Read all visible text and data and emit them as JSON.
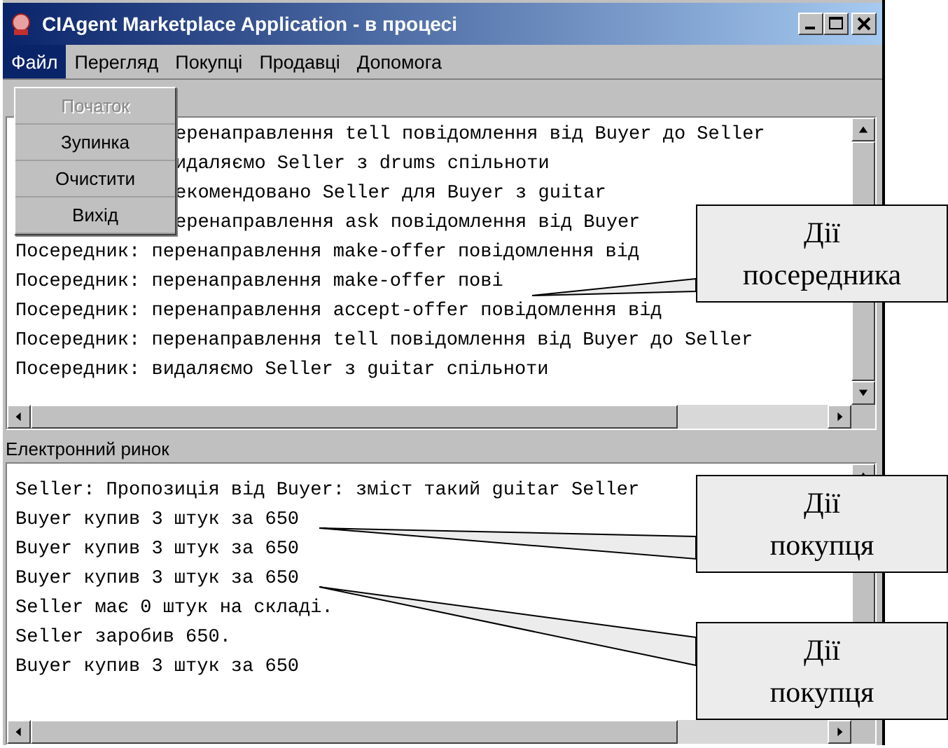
{
  "window": {
    "title": "CIAgent Marketplace Application - в процесі"
  },
  "menu_bar": [
    {
      "label": "Файл",
      "selected": true
    },
    {
      "label": "Перегляд",
      "selected": false
    },
    {
      "label": "Покупці",
      "selected": false
    },
    {
      "label": "Продавці",
      "selected": false
    },
    {
      "label": "Допомога",
      "selected": false
    }
  ],
  "file_menu": [
    {
      "label": "Початок",
      "disabled": true
    },
    {
      "label": "Зупинка",
      "disabled": false
    },
    {
      "label": "Очистити",
      "disabled": false
    },
    {
      "label": "Вихід",
      "disabled": false
    }
  ],
  "log_panel": {
    "lines": [
      {
        "text": "еренаправлення tell повідомлення від Buyer до Seller",
        "kind": "covered"
      },
      {
        "text": "идаляємо Seller з drums спільноти",
        "kind": "covered"
      },
      {
        "text": "екомендовано Seller для Buyer з guitar",
        "kind": "covered"
      },
      {
        "text": "еренаправлення ask повідомлення від Buyer",
        "kind": "covered"
      },
      {
        "text": "Посередник: перенаправлення make-offer повідомлення від",
        "kind": "full"
      },
      {
        "text": "Посередник: перенаправлення make-offer пові",
        "kind": "full"
      },
      {
        "text": "Посередник: перенаправлення accept-offer повідомлення від",
        "kind": "full"
      },
      {
        "text": "Посередник: перенаправлення tell повідомлення від Buyer до Seller",
        "kind": "full"
      },
      {
        "text": "Посередник: видаляємо Seller з guitar спільноти",
        "kind": "full"
      }
    ]
  },
  "market_panel": {
    "title": "Електронний ринок",
    "lines": [
      {
        "text": "Seller: Пропозиція від Buyer: зміст такий guitar Seller"
      },
      {
        "text": "Buyer купив 3 штук за 650"
      },
      {
        "text": "Buyer купив 3 штук за 650"
      },
      {
        "text": "Buyer купив 3 штук за 650"
      },
      {
        "text": "Seller має 0 штук на складі."
      },
      {
        "text": "Seller заробив 650."
      },
      {
        "text": "Buyer купив 3 штук за 650"
      }
    ]
  },
  "callouts": [
    {
      "lines": [
        "Дії",
        "посередника"
      ]
    },
    {
      "lines": [
        "Дії",
        "покупця"
      ]
    },
    {
      "lines": [
        "Дії",
        "покупця"
      ]
    }
  ]
}
